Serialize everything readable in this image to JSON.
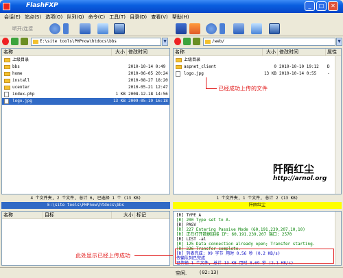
{
  "window": {
    "title": "FlashFXP"
  },
  "menu": [
    "会话(E)",
    "站点(S)",
    "选项(O)",
    "队列(Q)",
    "命令(C)",
    "工具(T)",
    "目录(D)",
    "查看(V)",
    "帮助(H)"
  ],
  "toolbar": {
    "connect_label": "断开/连接"
  },
  "left": {
    "path": "E:\\site tools\\PHPnow\\htdocs\\bbs",
    "columns": [
      "名称",
      "大小",
      "修改时间"
    ],
    "up_label": "上级目录",
    "rows": [
      {
        "name": "bbs",
        "type": "folder",
        "size": "",
        "date": "2010-10-14 0:49"
      },
      {
        "name": "home",
        "type": "folder",
        "size": "",
        "date": "2010-06-05 20:24"
      },
      {
        "name": "install",
        "type": "folder",
        "size": "",
        "date": "2010-08-27 18:20"
      },
      {
        "name": "ucenter",
        "type": "folder",
        "size": "",
        "date": "2010-05-21 12:47"
      },
      {
        "name": "index.php",
        "type": "file",
        "size": "1 KB",
        "date": "2008-12-18 14:56"
      },
      {
        "name": "logo.jpg",
        "type": "file",
        "size": "13 KB",
        "date": "2009-05-19 16:18",
        "selected": true
      }
    ],
    "status": "4 个文件夹, 2 个文件, 总计 6, 已选择 1 个 (13 KB)",
    "pathstatus": "E:\\site tools\\PHPnow\\htdocs\\bbs"
  },
  "right": {
    "path": "/web/",
    "columns": [
      "名称",
      "大小",
      "修改时间",
      "属性"
    ],
    "up_label": "上级目录",
    "rows": [
      {
        "name": "aspnet_client",
        "type": "folder",
        "size": "0",
        "date": "2010-10-10 19:12",
        "attr": "D"
      },
      {
        "name": "logo.jpg",
        "type": "file",
        "size": "13 KB",
        "date": "2010-10-14 0:55",
        "attr": "-"
      }
    ],
    "status": "1 个文件夹, 1 个文件, 总计 2 (13 KB)",
    "sitename": "阡陌红尘"
  },
  "annotations": {
    "uploaded": "已经成功上传的文件",
    "log_note": "此处显示已经上传成功",
    "brand": "阡陌红尘",
    "url": "http://arnol.org"
  },
  "queue": {
    "columns": [
      "名称",
      "目标",
      "大小",
      "标记"
    ]
  },
  "log": [
    {
      "text": "[R] TYPE A",
      "color": "#000000"
    },
    {
      "text": "[R] 200 Type set to A.",
      "color": "#008000"
    },
    {
      "text": "[R] PASV",
      "color": "#000000"
    },
    {
      "text": "[R] 227 Entering Passive Mode (60,191,239,207,10,10)",
      "color": "#008000"
    },
    {
      "text": "[R] 正在打开数据连接 IP: 60.191.239.207 端口: 2570",
      "color": "#008000"
    },
    {
      "text": "[R] LIST -al",
      "color": "#000000"
    },
    {
      "text": "[R] 125 Data connection already open; Transfer starting.",
      "color": "#008000"
    },
    {
      "text": "[R] 226 Transfer complete.",
      "color": "#008000"
    },
    {
      "text": "[R] 列表完成: 99 字节 用时 0.56 秒 (0.2 KB/s)",
      "color": "#0000c0"
    },
    {
      "text": "传输队列已完成",
      "color": "#0000c0"
    },
    {
      "text": "已传输 1 个文件, 总计 13 KB 用时 8.69 秒 (2.1 KB/s)",
      "color": "#0000c0"
    }
  ],
  "statusbar": {
    "left": "空闲.",
    "right": "(02:13)"
  },
  "colors": {
    "accent": "#316ac5",
    "highlight": "#e21b1b",
    "site_bar": "#ffff00"
  }
}
